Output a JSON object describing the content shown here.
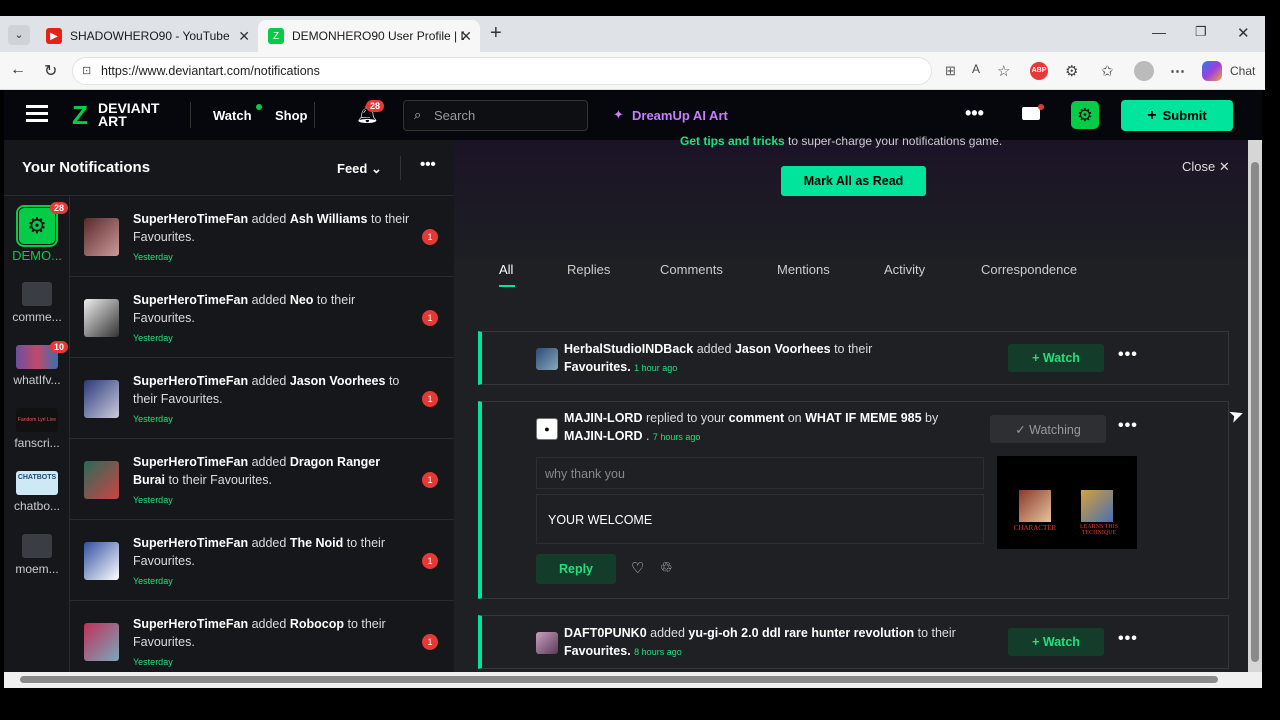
{
  "browser": {
    "tabs": [
      {
        "title": "SHADOWHERO90 - YouTube",
        "icon": "youtube-icon"
      },
      {
        "title": "DEMONHERO90 User Profile | Dev",
        "icon": "deviantart-icon"
      }
    ],
    "url": "https://www.deviantart.com/notifications",
    "chat_label": "Chat"
  },
  "nav": {
    "logo_line1": "DEVIANT",
    "logo_line2": "ART",
    "watch": "Watch",
    "shop": "Shop",
    "bell_badge": "28",
    "search_placeholder": "Search",
    "dreamup": "DreamUp AI Art",
    "submit": "Submit"
  },
  "left": {
    "title": "Your Notifications",
    "feed_label": "Feed",
    "rail": [
      {
        "label": "DEMO...",
        "badge": "28"
      },
      {
        "label": "comme...",
        "badge": ""
      },
      {
        "label": "whatIfv...",
        "badge": "10"
      },
      {
        "label": "fanscri...",
        "badge": ""
      },
      {
        "label": "chatbo...",
        "badge": ""
      },
      {
        "label": "moem...",
        "badge": ""
      }
    ],
    "rail_thumb_text": {
      "fanscri": "Fandom Lyri Live",
      "chatbo": "CHATBOTS"
    },
    "feed": [
      {
        "user": "SuperHeroTimeFan",
        "verb": "added",
        "item": "Ash Williams",
        "tail": "to their Favourites.",
        "time": "Yesterday",
        "count": "1"
      },
      {
        "user": "SuperHeroTimeFan",
        "verb": "added",
        "item": "Neo",
        "tail": "to their Favourites.",
        "time": "Yesterday",
        "count": "1"
      },
      {
        "user": "SuperHeroTimeFan",
        "verb": "added",
        "item": "Jason Voorhees",
        "tail": "to their Favourites.",
        "time": "Yesterday",
        "count": "1"
      },
      {
        "user": "SuperHeroTimeFan",
        "verb": "added",
        "item": "Dragon Ranger Burai",
        "tail": "to their Favourites.",
        "time": "Yesterday",
        "count": "1"
      },
      {
        "user": "SuperHeroTimeFan",
        "verb": "added",
        "item": "The Noid",
        "tail": "to their Favourites.",
        "time": "Yesterday",
        "count": "1"
      },
      {
        "user": "SuperHeroTimeFan",
        "verb": "added",
        "item": "Robocop",
        "tail": "to their Favourites.",
        "time": "Yesterday",
        "count": "1"
      }
    ]
  },
  "main": {
    "tip_bold": "Get tips and tricks",
    "tip_rest": "to super-charge your notifications game.",
    "close": "Close",
    "mark_all": "Mark All as Read",
    "tabs": [
      "All",
      "Replies",
      "Comments",
      "Mentions",
      "Activity",
      "Correspondence"
    ],
    "card1": {
      "user": "HerbalStudioINDBack",
      "verb": "added",
      "item": "Jason Voorhees",
      "tail": "to their",
      "fav": "Favourites.",
      "time": "1 hour ago",
      "btn": "+ Watch"
    },
    "card2": {
      "user": "MAJIN-LORD",
      "verb": "replied to your",
      "obj": "comment",
      "on": "on",
      "title": "WHAT IF MEME 985",
      "by": "by",
      "user2": "MAJIN-LORD",
      "time": "7 hours ago",
      "btn": "✓ Watching",
      "quote": "why thank you",
      "reply_text": "YOUR WELCOME",
      "reply_btn": "Reply",
      "thumb_left": "CHARACTER",
      "thumb_right": "LEARNS THIS TECHNIQUE"
    },
    "card3": {
      "user": "DAFT0PUNK0",
      "verb": "added",
      "item": "yu-gi-oh 2.0 ddl rare hunter revolution",
      "tail": "to their",
      "fav": "Favourites.",
      "time": "8 hours ago",
      "btn": "+ Watch"
    }
  }
}
